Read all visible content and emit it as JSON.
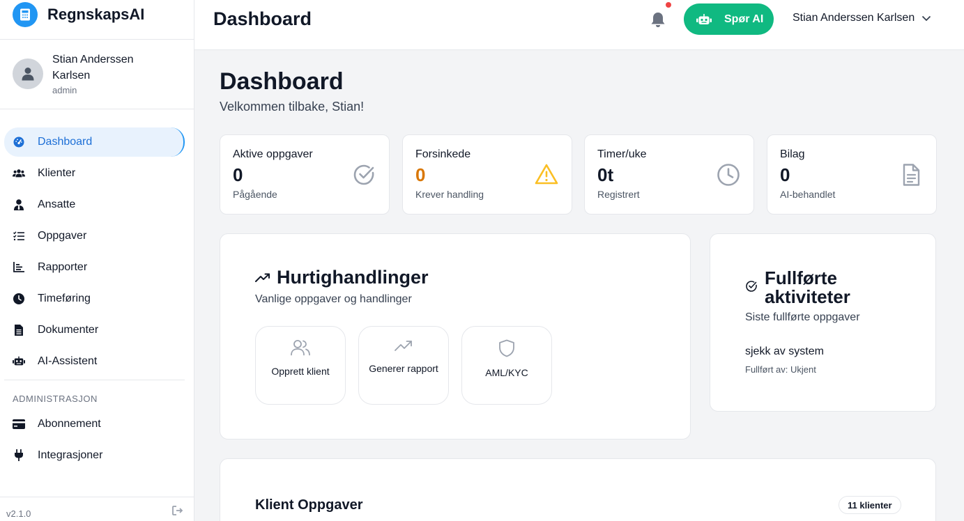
{
  "app": {
    "name": "RegnskapsAI",
    "version": "v2.1.0"
  },
  "user": {
    "name": "Stian Anderssen Karlsen",
    "role": "admin"
  },
  "sidebar": {
    "items": [
      {
        "label": "Dashboard",
        "icon": "dashboard-icon",
        "active": true
      },
      {
        "label": "Klienter",
        "icon": "users-icon"
      },
      {
        "label": "Ansatte",
        "icon": "user-tie-icon"
      },
      {
        "label": "Oppgaver",
        "icon": "tasks-icon"
      },
      {
        "label": "Rapporter",
        "icon": "chart-icon"
      },
      {
        "label": "Timeføring",
        "icon": "clock-icon"
      },
      {
        "label": "Dokumenter",
        "icon": "document-icon"
      },
      {
        "label": "AI-Assistent",
        "icon": "robot-icon"
      }
    ],
    "admin_section": "ADMINISTRASJON",
    "admin_items": [
      {
        "label": "Abonnement",
        "icon": "credit-card-icon"
      },
      {
        "label": "Integrasjoner",
        "icon": "plug-icon"
      }
    ]
  },
  "topbar": {
    "title": "Dashboard",
    "ask_ai": "Spør AI",
    "user_name": "Stian Anderssen Karlsen"
  },
  "main": {
    "title": "Dashboard",
    "subtitle": "Velkommen tilbake, Stian!",
    "stats": [
      {
        "label": "Aktive oppgaver",
        "value": "0",
        "sub": "Pågående",
        "icon": "check-circle-icon"
      },
      {
        "label": "Forsinkede",
        "value": "0",
        "sub": "Krever handling",
        "icon": "warning-icon"
      },
      {
        "label": "Timer/uke",
        "value": "0t",
        "sub": "Registrert",
        "icon": "clock-icon"
      },
      {
        "label": "Bilag",
        "value": "0",
        "sub": "AI-behandlet",
        "icon": "file-icon"
      }
    ],
    "quick_actions": {
      "title": "Hurtighandlinger",
      "subtitle": "Vanlige oppgaver og handlinger",
      "buttons": [
        {
          "label": "Opprett klient",
          "icon": "users-icon"
        },
        {
          "label": "Generer rapport",
          "icon": "trending-up-icon"
        },
        {
          "label": "AML/KYC",
          "icon": "shield-icon"
        }
      ]
    },
    "completed": {
      "title": "Fullførte aktiviteter",
      "subtitle": "Siste fullførte oppgaver",
      "item": "sjekk av system",
      "meta": "Fullført av: Ukjent"
    },
    "client_tasks": {
      "title": "Klient Oppgaver",
      "badge": "11 klienter"
    }
  },
  "colors": {
    "accent": "#2196f3",
    "ai_button": "#10b981",
    "warning": "#d97706",
    "notification_dot": "#ef4444"
  }
}
